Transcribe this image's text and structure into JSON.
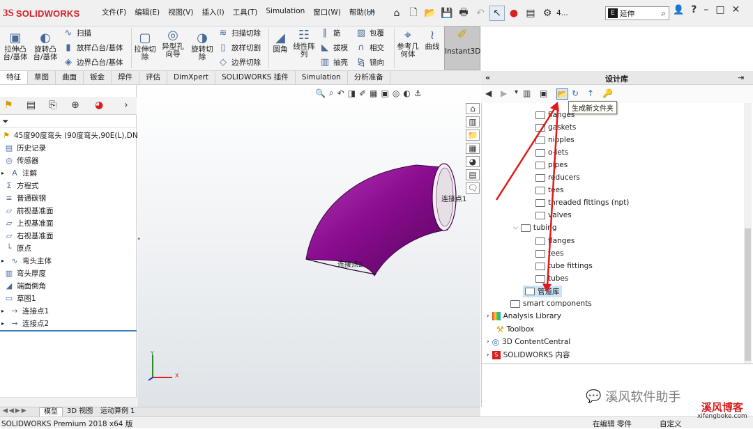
{
  "app": {
    "logo_ds": "3S",
    "logo_text": "SOLIDWORKS"
  },
  "menu": [
    "文件(F)",
    "编辑(E)",
    "视图(V)",
    "插入(I)",
    "工具(T)",
    "Simulation",
    "窗口(W)",
    "帮助(H)"
  ],
  "quick_access": {
    "search_placeholder": "延伸",
    "search_lead": "E",
    "overflow_label": "4..."
  },
  "ribbon": {
    "extrude_boss": "拉伸凸台/基体",
    "revolve_boss": "旋转凸台/基体",
    "sweep": "扫描",
    "loft_boss": "放样凸台/基体",
    "boundary_boss": "边界凸台/基体",
    "extrude_cut": "拉伸切除",
    "hole_wizard": "异型孔向导",
    "revolve_cut": "旋转切除",
    "sweep_cut": "扫描切除",
    "loft_cut": "放样切割",
    "boundary_cut": "边界切除",
    "fillet": "圆角",
    "linear_pattern": "线性阵列",
    "rib": "筋",
    "draft": "拔模",
    "shell": "抽壳",
    "wrap": "包覆",
    "intersect": "相交",
    "mirror": "镜向",
    "ref_geometry": "参考几何体",
    "curves": "曲线",
    "instant3d": "Instant3D"
  },
  "command_tabs": [
    {
      "label": "特征",
      "active": true
    },
    {
      "label": "草图",
      "active": false
    },
    {
      "label": "曲面",
      "active": false
    },
    {
      "label": "钣金",
      "active": false
    },
    {
      "label": "焊件",
      "active": false
    },
    {
      "label": "评估",
      "active": false
    },
    {
      "label": "DimXpert",
      "active": false
    },
    {
      "label": "SOLIDWORKS 插件",
      "active": false
    },
    {
      "label": "Simulation",
      "active": false
    },
    {
      "label": "分析准备",
      "active": false
    }
  ],
  "feature_tree": {
    "root": "45度90度弯头 (90度弯头,90E(L),DN12",
    "items": [
      "历史记录",
      "传感器",
      "注解",
      "方程式",
      "普通碳钢",
      "前视基准面",
      "上视基准面",
      "右视基准面",
      "原点",
      "弯头主体",
      "弯头厚度",
      "端面倒角",
      "草图1",
      "连接点1",
      "连接点2"
    ]
  },
  "graphics": {
    "conn_label_1": "连接点1",
    "conn_label_2": "连接点2",
    "triad_x": "X",
    "triad_y": "Y",
    "elbow_color": "#8a0c8f"
  },
  "design_library": {
    "title": "设计库",
    "tooltip": "生成新文件夹",
    "items": [
      {
        "label": "flanges",
        "indent": 2
      },
      {
        "label": "gaskets",
        "indent": 2
      },
      {
        "label": "nipples",
        "indent": 2
      },
      {
        "label": "o-lets",
        "indent": 2
      },
      {
        "label": "pipes",
        "indent": 2
      },
      {
        "label": "reducers",
        "indent": 2
      },
      {
        "label": "tees",
        "indent": 2
      },
      {
        "label": "threaded fittings (npt)",
        "indent": 2
      },
      {
        "label": "valves",
        "indent": 2
      },
      {
        "label": "tubing",
        "indent": 1
      },
      {
        "label": "flanges",
        "indent": 2
      },
      {
        "label": "tees",
        "indent": 2
      },
      {
        "label": "tube fittings",
        "indent": 2
      },
      {
        "label": "tubes",
        "indent": 2
      },
      {
        "label": "管道库",
        "indent": 1,
        "selected": true
      },
      {
        "label": "smart components",
        "indent": 0
      }
    ],
    "roots": [
      {
        "label": "Analysis Library",
        "icon": "analysis-library-icon"
      },
      {
        "label": "Toolbox",
        "icon": "toolbox-icon"
      },
      {
        "label": "3D ContentCentral",
        "icon": "globe-icon"
      },
      {
        "label": "SOLIDWORKS 内容",
        "icon": "sw-content-icon"
      }
    ]
  },
  "bottom_tabs": [
    "模型",
    "3D 视图",
    "运动算例 1"
  ],
  "status": {
    "product": "SOLIDWORKS Premium 2018 x64 版",
    "editing": "在编辑 零件",
    "custom": "自定义"
  },
  "watermark": {
    "wechat": "溪风软件助手",
    "blog": "溪风博客",
    "blog_url": "xifengboke.com"
  },
  "colors": {
    "accent_red": "#d62020",
    "elbow": "#8a0c8f",
    "selection": "#cce4f7"
  }
}
